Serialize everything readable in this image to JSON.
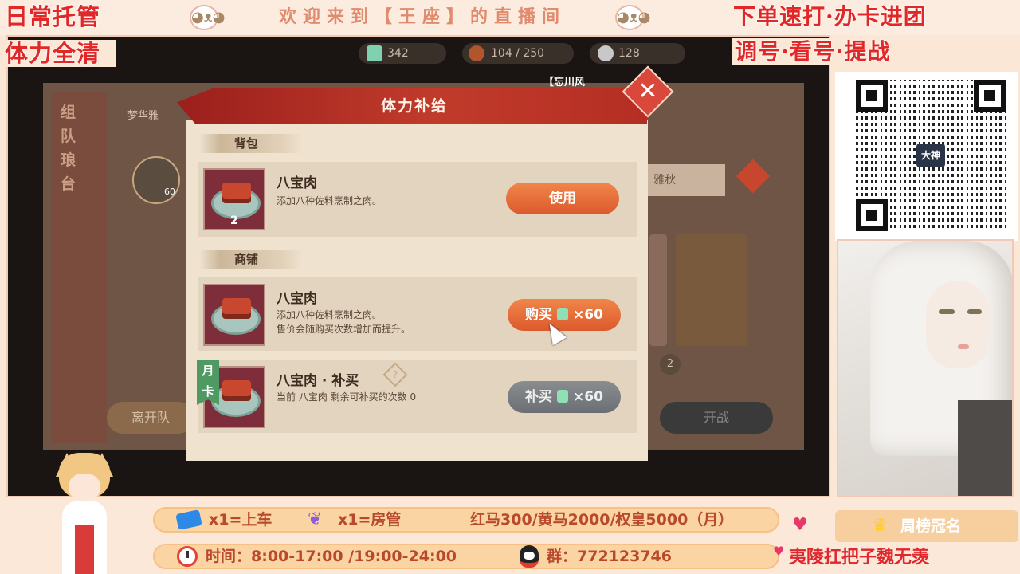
{
  "overlay": {
    "top_left_line1": "日常托管",
    "top_left_line2": "体力全清",
    "welcome": "欢迎来到【王座】的直播间",
    "top_right_line1": "下单速打·办卡进团",
    "top_right_line2": "调号·看号·提战"
  },
  "game": {
    "resources": [
      {
        "icon": "jade-icon",
        "value": "342"
      },
      {
        "icon": "meat-icon",
        "value": "104 / 250"
      },
      {
        "icon": "coin-icon",
        "value": "128"
      }
    ],
    "side_title": "组队琅台",
    "banner_tag": "【忘川风",
    "bg_title": "梦华雅",
    "bg_name_right": "雅秋",
    "bg_btn_left": "离开队",
    "bg_btn_right": "开战",
    "bg_badge": "2",
    "avatar_level": "60"
  },
  "dialog": {
    "title": "体力补给",
    "close_label": "✕",
    "bag_section": "背包",
    "shop_section": "商铺",
    "items": [
      {
        "name": "八宝肉",
        "desc1": "添加八种佐料烹制之肉。",
        "desc2": "",
        "qty": "2",
        "button": "使用",
        "price": ""
      },
      {
        "name": "八宝肉",
        "desc1": "添加八种佐料烹制之肉。",
        "desc2": "售价会随购买次数增加而提升。",
        "qty": "",
        "button": "购买",
        "price": "×60"
      },
      {
        "name": "八宝肉 · 补买",
        "desc1": "当前 八宝肉 剩余可补买的次数 0",
        "desc2": "",
        "qty": "",
        "button": "补买",
        "price": "×60",
        "badge": "月卡"
      }
    ]
  },
  "qr": {
    "logo": "大神"
  },
  "bottom": {
    "ticket_text": "x1=上车",
    "wing_text": "x1=房管",
    "prices": "红马300/黄马2000/权皇5000（月）",
    "time_text": "时间：8:00-17:00 /19:00-24:00",
    "group_text": "群：772123746",
    "rank_title": "周榜冠名",
    "rank_name": "夷陵扛把子魏无羡"
  },
  "colors": {
    "accent_red": "#e02828",
    "dialog_header": "#c13b2b",
    "btn_orange": "#dc5a2c",
    "btn_gray": "#6b6f73",
    "frame_pink": "#f1c9b4"
  }
}
